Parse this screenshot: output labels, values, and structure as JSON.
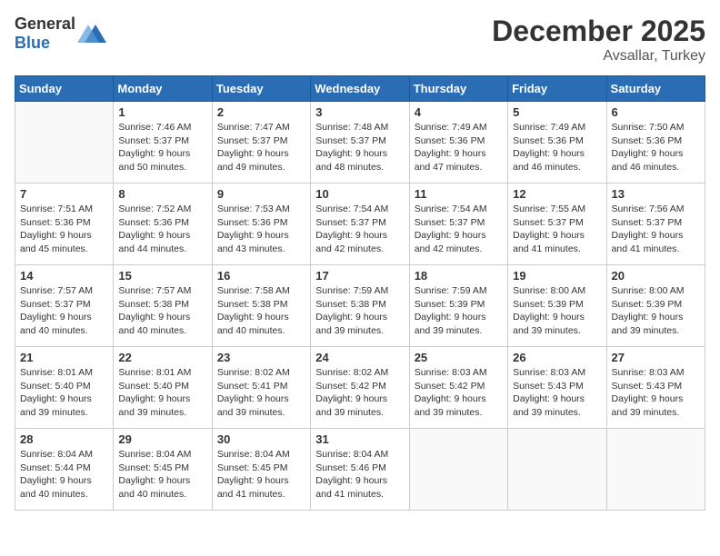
{
  "header": {
    "logo_general": "General",
    "logo_blue": "Blue",
    "month": "December 2025",
    "location": "Avsallar, Turkey"
  },
  "weekdays": [
    "Sunday",
    "Monday",
    "Tuesday",
    "Wednesday",
    "Thursday",
    "Friday",
    "Saturday"
  ],
  "weeks": [
    [
      {
        "day": "",
        "info": ""
      },
      {
        "day": "1",
        "info": "Sunrise: 7:46 AM\nSunset: 5:37 PM\nDaylight: 9 hours\nand 50 minutes."
      },
      {
        "day": "2",
        "info": "Sunrise: 7:47 AM\nSunset: 5:37 PM\nDaylight: 9 hours\nand 49 minutes."
      },
      {
        "day": "3",
        "info": "Sunrise: 7:48 AM\nSunset: 5:37 PM\nDaylight: 9 hours\nand 48 minutes."
      },
      {
        "day": "4",
        "info": "Sunrise: 7:49 AM\nSunset: 5:36 PM\nDaylight: 9 hours\nand 47 minutes."
      },
      {
        "day": "5",
        "info": "Sunrise: 7:49 AM\nSunset: 5:36 PM\nDaylight: 9 hours\nand 46 minutes."
      },
      {
        "day": "6",
        "info": "Sunrise: 7:50 AM\nSunset: 5:36 PM\nDaylight: 9 hours\nand 46 minutes."
      }
    ],
    [
      {
        "day": "7",
        "info": "Sunrise: 7:51 AM\nSunset: 5:36 PM\nDaylight: 9 hours\nand 45 minutes."
      },
      {
        "day": "8",
        "info": "Sunrise: 7:52 AM\nSunset: 5:36 PM\nDaylight: 9 hours\nand 44 minutes."
      },
      {
        "day": "9",
        "info": "Sunrise: 7:53 AM\nSunset: 5:36 PM\nDaylight: 9 hours\nand 43 minutes."
      },
      {
        "day": "10",
        "info": "Sunrise: 7:54 AM\nSunset: 5:37 PM\nDaylight: 9 hours\nand 42 minutes."
      },
      {
        "day": "11",
        "info": "Sunrise: 7:54 AM\nSunset: 5:37 PM\nDaylight: 9 hours\nand 42 minutes."
      },
      {
        "day": "12",
        "info": "Sunrise: 7:55 AM\nSunset: 5:37 PM\nDaylight: 9 hours\nand 41 minutes."
      },
      {
        "day": "13",
        "info": "Sunrise: 7:56 AM\nSunset: 5:37 PM\nDaylight: 9 hours\nand 41 minutes."
      }
    ],
    [
      {
        "day": "14",
        "info": "Sunrise: 7:57 AM\nSunset: 5:37 PM\nDaylight: 9 hours\nand 40 minutes."
      },
      {
        "day": "15",
        "info": "Sunrise: 7:57 AM\nSunset: 5:38 PM\nDaylight: 9 hours\nand 40 minutes."
      },
      {
        "day": "16",
        "info": "Sunrise: 7:58 AM\nSunset: 5:38 PM\nDaylight: 9 hours\nand 40 minutes."
      },
      {
        "day": "17",
        "info": "Sunrise: 7:59 AM\nSunset: 5:38 PM\nDaylight: 9 hours\nand 39 minutes."
      },
      {
        "day": "18",
        "info": "Sunrise: 7:59 AM\nSunset: 5:39 PM\nDaylight: 9 hours\nand 39 minutes."
      },
      {
        "day": "19",
        "info": "Sunrise: 8:00 AM\nSunset: 5:39 PM\nDaylight: 9 hours\nand 39 minutes."
      },
      {
        "day": "20",
        "info": "Sunrise: 8:00 AM\nSunset: 5:39 PM\nDaylight: 9 hours\nand 39 minutes."
      }
    ],
    [
      {
        "day": "21",
        "info": "Sunrise: 8:01 AM\nSunset: 5:40 PM\nDaylight: 9 hours\nand 39 minutes."
      },
      {
        "day": "22",
        "info": "Sunrise: 8:01 AM\nSunset: 5:40 PM\nDaylight: 9 hours\nand 39 minutes."
      },
      {
        "day": "23",
        "info": "Sunrise: 8:02 AM\nSunset: 5:41 PM\nDaylight: 9 hours\nand 39 minutes."
      },
      {
        "day": "24",
        "info": "Sunrise: 8:02 AM\nSunset: 5:42 PM\nDaylight: 9 hours\nand 39 minutes."
      },
      {
        "day": "25",
        "info": "Sunrise: 8:03 AM\nSunset: 5:42 PM\nDaylight: 9 hours\nand 39 minutes."
      },
      {
        "day": "26",
        "info": "Sunrise: 8:03 AM\nSunset: 5:43 PM\nDaylight: 9 hours\nand 39 minutes."
      },
      {
        "day": "27",
        "info": "Sunrise: 8:03 AM\nSunset: 5:43 PM\nDaylight: 9 hours\nand 39 minutes."
      }
    ],
    [
      {
        "day": "28",
        "info": "Sunrise: 8:04 AM\nSunset: 5:44 PM\nDaylight: 9 hours\nand 40 minutes."
      },
      {
        "day": "29",
        "info": "Sunrise: 8:04 AM\nSunset: 5:45 PM\nDaylight: 9 hours\nand 40 minutes."
      },
      {
        "day": "30",
        "info": "Sunrise: 8:04 AM\nSunset: 5:45 PM\nDaylight: 9 hours\nand 41 minutes."
      },
      {
        "day": "31",
        "info": "Sunrise: 8:04 AM\nSunset: 5:46 PM\nDaylight: 9 hours\nand 41 minutes."
      },
      {
        "day": "",
        "info": ""
      },
      {
        "day": "",
        "info": ""
      },
      {
        "day": "",
        "info": ""
      }
    ]
  ]
}
